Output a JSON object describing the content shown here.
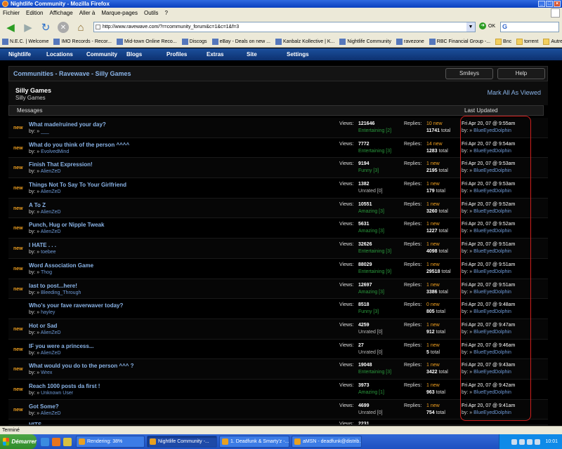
{
  "window": {
    "title": "Nightlife Community - Mozilla Firefox"
  },
  "menu": [
    "Fichier",
    "Edition",
    "Affichage",
    "Aller à",
    "Marque-pages",
    "Outils",
    "?"
  ],
  "browser": {
    "url": "http://www.ravewave.com/?r=community_forum&c=1&c=1&f=3",
    "go_label": "OK"
  },
  "bookmarks": [
    {
      "label": "N.E.C. | Welcome",
      "folder": false
    },
    {
      "label": "IMO Records - Recor...",
      "folder": false
    },
    {
      "label": "Mid-town Online Reco...",
      "folder": false
    },
    {
      "label": "Discogs",
      "folder": false
    },
    {
      "label": "eBay - Deals on new ...",
      "folder": false
    },
    {
      "label": "Kanbalz Kollective | K...",
      "folder": false
    },
    {
      "label": "Nightlife Community",
      "folder": false
    },
    {
      "label": "ravezone",
      "folder": false
    },
    {
      "label": "RBC Financial Group -...",
      "folder": false
    },
    {
      "label": "Bnc",
      "folder": true
    },
    {
      "label": "torrent",
      "folder": true
    },
    {
      "label": "Autres",
      "folder": true
    }
  ],
  "site_nav": [
    "Nightlife",
    "Locations",
    "Community",
    "Blogs",
    "Profiles",
    "Extras",
    "Site",
    "Settings"
  ],
  "header": {
    "title": "Communities - Ravewave - Silly Games",
    "smileys": "Smileys",
    "help": "Help"
  },
  "forum": {
    "title": "Silly Games",
    "subtitle": "Silly Games",
    "mark_all": "Mark All As Viewed",
    "col_messages": "Messages",
    "col_updated": "Last Updated"
  },
  "labels": {
    "new": "new",
    "by": "by: »",
    "views": "Views:",
    "replies": "Replies:",
    "total": "total"
  },
  "threads": [
    {
      "new": true,
      "title": "What made/ruined your day?",
      "author": "___",
      "views": "121646",
      "rating": "Entertaining [2]",
      "rating_kind": "rated",
      "replies_new": "10 new",
      "replies_total": "11741",
      "date": "Fri Apr 20, 07 @ 9:55am",
      "last_by": "BlueEyedDolphin"
    },
    {
      "new": true,
      "title": "What do you think of the person ^^^^",
      "author": "EvolvedMind",
      "views": "7772",
      "rating": "Entertaining [3]",
      "rating_kind": "rated",
      "replies_new": "14 new",
      "replies_total": "1283",
      "date": "Fri Apr 20, 07 @ 9:54am",
      "last_by": "BlueEyedDolphin"
    },
    {
      "new": true,
      "title": "Finish That Expression!",
      "author": "AlienZeD",
      "views": "9194",
      "rating": "Funny [3]",
      "rating_kind": "rated",
      "replies_new": "1 new",
      "replies_total": "2195",
      "date": "Fri Apr 20, 07 @ 9:53am",
      "last_by": "BlueEyedDolphin"
    },
    {
      "new": true,
      "title": "Things Not To Say To Your Girlfriend",
      "author": "AlienZeD",
      "views": "1382",
      "rating": "Unrated [0]",
      "rating_kind": "unrated",
      "replies_new": "1 new",
      "replies_total": "179",
      "date": "Fri Apr 20, 07 @ 9:53am",
      "last_by": "BlueEyedDolphin"
    },
    {
      "new": true,
      "title": "A To Z",
      "author": "AlienZeD",
      "views": "10551",
      "rating": "Amazing [3]",
      "rating_kind": "rated",
      "replies_new": "1 new",
      "replies_total": "3260",
      "date": "Fri Apr 20, 07 @ 9:52am",
      "last_by": "BlueEyedDolphin"
    },
    {
      "new": true,
      "title": "Punch, Hug or Nipple Tweak",
      "author": "AlienZeD",
      "views": "5631",
      "rating": "Amazing [3]",
      "rating_kind": "rated",
      "replies_new": "1 new",
      "replies_total": "1227",
      "date": "Fri Apr 20, 07 @ 9:52am",
      "last_by": "BlueEyedDolphin"
    },
    {
      "new": true,
      "title": "I HATE . . .",
      "author": "toebee",
      "views": "32626",
      "rating": "Entertaining [3]",
      "rating_kind": "rated",
      "replies_new": "1 new",
      "replies_total": "4098",
      "date": "Fri Apr 20, 07 @ 9:51am",
      "last_by": "BlueEyedDolphin"
    },
    {
      "new": true,
      "title": "Word Association Game",
      "author": "Thog",
      "views": "88029",
      "rating": "Entertaining [9]",
      "rating_kind": "rated",
      "replies_new": "1 new",
      "replies_total": "29518",
      "date": "Fri Apr 20, 07 @ 9:51am",
      "last_by": "BlueEyedDolphin"
    },
    {
      "new": true,
      "title": "last to post...here!",
      "author": "Bleeding_Through",
      "views": "12697",
      "rating": "Amazing [3]",
      "rating_kind": "rated",
      "replies_new": "1 new",
      "replies_total": "3386",
      "date": "Fri Apr 20, 07 @ 9:51am",
      "last_by": "BlueEyedDolphin"
    },
    {
      "new": false,
      "title": "Who's your fave raverwaver today?",
      "author": "hayley",
      "views": "8518",
      "rating": "Funny [3]",
      "rating_kind": "rated",
      "replies_new": "0 new",
      "replies_total": "805",
      "date": "Fri Apr 20, 07 @ 9:48am",
      "last_by": "BlueEyedDolphin"
    },
    {
      "new": true,
      "title": "Hot or Sad",
      "author": "AlienZeD",
      "views": "4259",
      "rating": "Unrated [0]",
      "rating_kind": "unrated",
      "replies_new": "1 new",
      "replies_total": "912",
      "date": "Fri Apr 20, 07 @ 9:47am",
      "last_by": "BlueEyedDolphin"
    },
    {
      "new": true,
      "title": "IF you were a princess...",
      "author": "AlienZeD",
      "views": "27",
      "rating": "Unrated [0]",
      "rating_kind": "unrated",
      "replies_new": "1 new",
      "replies_total": "5",
      "date": "Fri Apr 20, 07 @ 9:46am",
      "last_by": "BlueEyedDolphin"
    },
    {
      "new": true,
      "title": "What would you do to the person ^^^ ?",
      "author": "Wrex",
      "views": "19048",
      "rating": "Entertaining [3]",
      "rating_kind": "rated",
      "replies_new": "1 new",
      "replies_total": "3422",
      "date": "Fri Apr 20, 07 @ 9:43am",
      "last_by": "BlueEyedDolphin"
    },
    {
      "new": true,
      "title": "Reach 1000 posts da first !",
      "author": "Unknown User",
      "views": "3973",
      "rating": "Amazing [1]",
      "rating_kind": "rated",
      "replies_new": "1 new",
      "replies_total": "963",
      "date": "Fri Apr 20, 07 @ 9:42am",
      "last_by": "BlueEyedDolphin"
    },
    {
      "new": true,
      "title": "Got Some?",
      "author": "AlienZeD",
      "views": "4699",
      "rating": "Unrated [0]",
      "rating_kind": "unrated",
      "replies_new": "1 new",
      "replies_total": "754",
      "date": "Fri Apr 20, 07 @ 9:41am",
      "last_by": "BlueEyedDolphin"
    }
  ],
  "partial_row": {
    "title": "HITS",
    "views": "2231"
  },
  "status": "Terminé",
  "taskbar": {
    "start": "Démarrer",
    "tasks": [
      {
        "label": "Rendering: 38%",
        "active": false
      },
      {
        "label": "Nightlife Community -...",
        "active": true
      },
      {
        "label": "1. Deadfunk & Smarty'z -...",
        "active": false
      },
      {
        "label": "aMSN - deadfunk@distrib...",
        "active": false
      }
    ],
    "clock": "10:01"
  },
  "colors": {
    "accent_blue": "#8ab4e8",
    "new_orange": "#f0a020",
    "rating_green": "#2a9a3c",
    "highlight_red": "#d0201e"
  }
}
